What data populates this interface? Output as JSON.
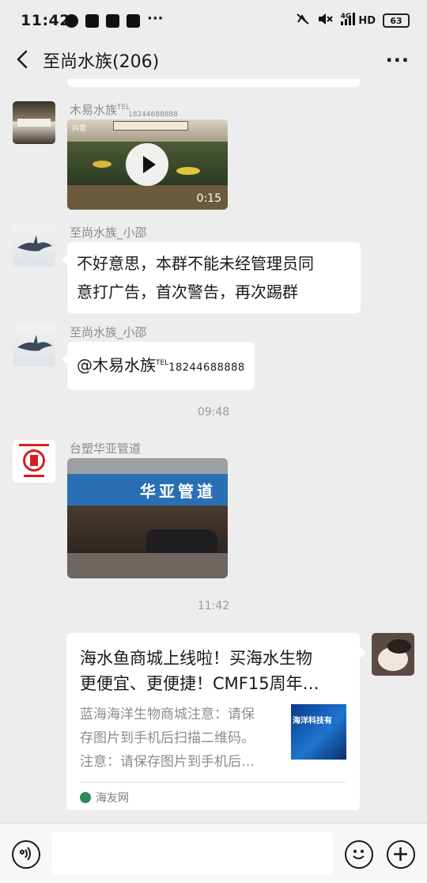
{
  "status_bar": {
    "time": "11:42",
    "network": "4G",
    "hd": "HD",
    "battery": "63"
  },
  "header": {
    "title": "至尚水族(206)",
    "menu": "···"
  },
  "messages": [
    {
      "sender_name": "木易水族",
      "sender_tel": "TEL",
      "sender_number": "18244688888",
      "type": "video",
      "video_duration": "0:15",
      "video_watermark": "抖音"
    },
    {
      "sender_name": "至尚水族_小邵",
      "type": "text",
      "line1": "不好意思，本群不能未经管理员同",
      "line2": "意打广告，首次警告，再次踢群"
    },
    {
      "sender_name": "至尚水族_小邵",
      "type": "mention",
      "mention": "@木易水族",
      "mention_tel": "TEL",
      "mention_number": "18244688888"
    },
    {
      "type": "timestamp",
      "time": "09:48"
    },
    {
      "sender_name": "台塑华亚管道",
      "type": "image",
      "sign_text": "华亚管道"
    },
    {
      "type": "timestamp",
      "time": "11:42"
    },
    {
      "type": "link_card",
      "title_line1": "海水鱼商城上线啦！买海水生物",
      "title_line2": "更便宜、更便捷！CMF15周年…",
      "desc_line1": "蓝海海洋生物商城注意：请保",
      "desc_line2": "存图片到手机后扫描二维码。",
      "desc_line3": "注意：请保存图片到手机后…",
      "thumb_text": "海洋科技有",
      "source": "海友网"
    }
  ],
  "input_bar": {
    "placeholder": ""
  },
  "colors": {
    "background": "#ededed",
    "bubble": "#ffffff",
    "accent_red": "#d81e1e",
    "link_blue": "#1e74d0"
  }
}
